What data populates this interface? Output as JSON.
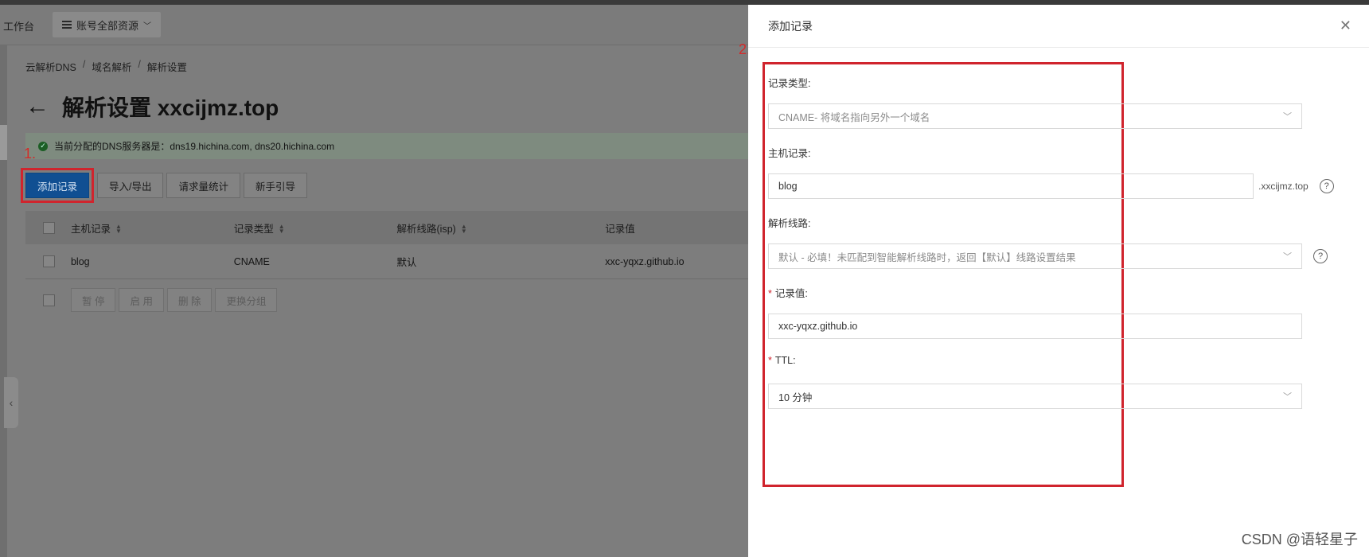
{
  "topbar": {
    "workbench": "工作台",
    "resource_label": "账号全部资源"
  },
  "breadcrumb": [
    "云解析DNS",
    "域名解析",
    "解析设置"
  ],
  "page_title": "解析设置 xxcijmz.top",
  "notice": "当前分配的DNS服务器是：dns19.hichina.com, dns20.hichina.com",
  "step_marks": {
    "one": "1.",
    "two": "2."
  },
  "toolbar": {
    "add": "添加记录",
    "import_export": "导入/导出",
    "stats": "请求量统计",
    "guide": "新手引导"
  },
  "table": {
    "headers": {
      "host": "主机记录",
      "type": "记录类型",
      "line": "解析线路(isp)",
      "value": "记录值"
    },
    "rows": [
      {
        "host": "blog",
        "type": "CNAME",
        "line": "默认",
        "value": "xxc-yqxz.github.io"
      }
    ],
    "batch": [
      "暂 停",
      "启 用",
      "删 除",
      "更换分组"
    ]
  },
  "drawer": {
    "title": "添加记录",
    "fields": {
      "record_type": {
        "label": "记录类型:",
        "value": "CNAME- 将域名指向另外一个域名"
      },
      "host": {
        "label": "主机记录:",
        "value": "blog",
        "suffix": ".xxcijmz.top"
      },
      "line": {
        "label": "解析线路:",
        "value": "默认 - 必填！未匹配到智能解析线路时，返回【默认】线路设置结果"
      },
      "record_value": {
        "label": "记录值:",
        "value": "xxc-yqxz.github.io"
      },
      "ttl": {
        "label": "TTL:",
        "value": "10 分钟"
      }
    }
  },
  "watermark": "CSDN @语轻星子",
  "colors": {
    "primary": "#104f92",
    "highlight": "#d0242d"
  }
}
